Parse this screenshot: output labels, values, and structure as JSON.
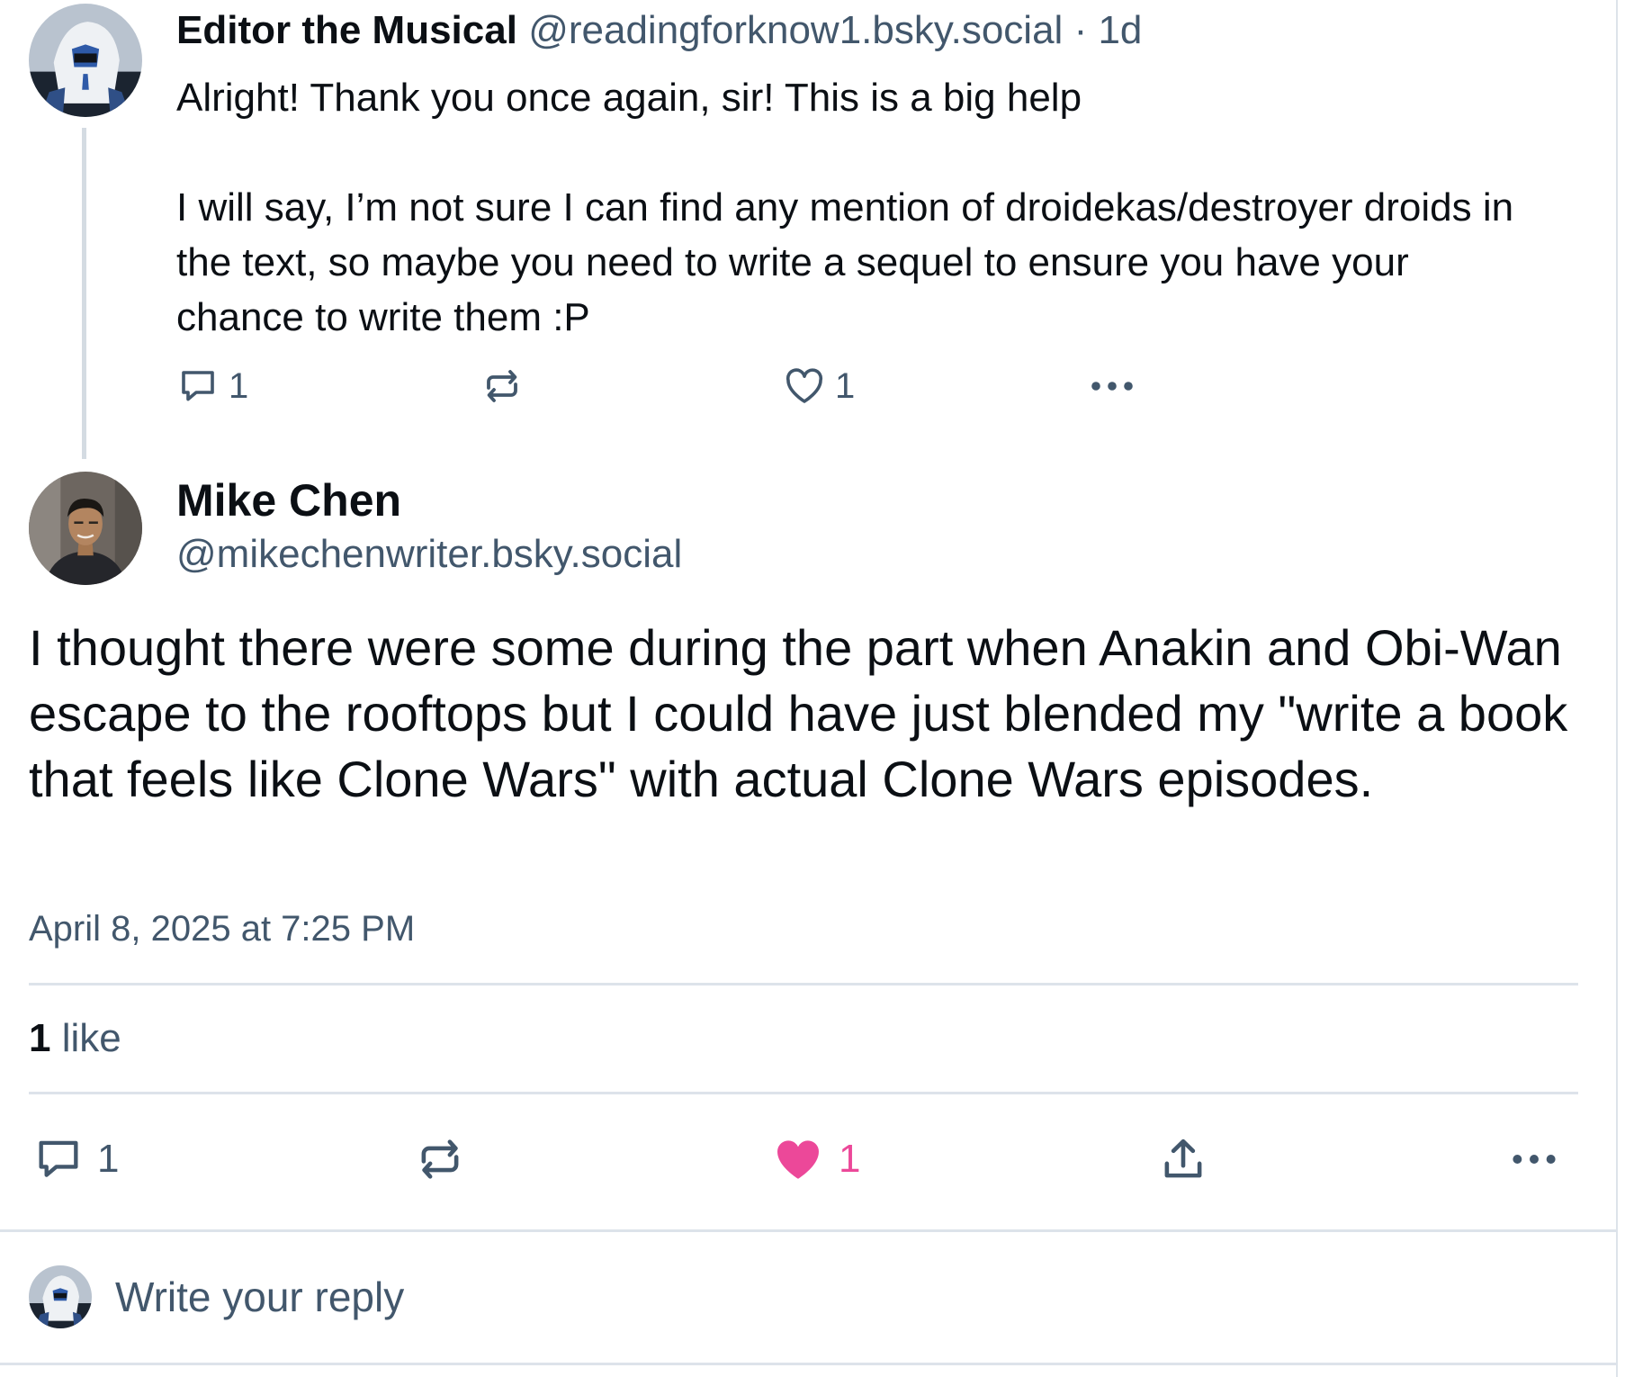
{
  "parent_post": {
    "author_name": "Editor the Musical",
    "handle": "@readingforknow1.bsky.social",
    "separator": "·",
    "age": "1d",
    "paragraphs": [
      "Alright! Thank you once again, sir! This is a big help",
      "I will say, I’m not sure I can find any mention of droidekas/destroyer droids in the text, so maybe you need to write a sequel to ensure you have your chance to write them :P"
    ],
    "reply_count": "1",
    "like_count": "1"
  },
  "main_post": {
    "author_name": "Mike Chen",
    "handle": "@mikechenwriter.bsky.social",
    "text": "I thought there were some during the part when Anakin and Obi-Wan escape to the rooftops but I could have just blended my \"write a book that feels like Clone Wars\" with actual Clone Wars episodes.",
    "timestamp": "April 8, 2025 at 7:25 PM",
    "likes_summary": {
      "count": "1",
      "label": "like"
    },
    "reply_count": "1",
    "like_count": "1",
    "liked": true
  },
  "composer": {
    "placeholder": "Write your reply"
  },
  "colors": {
    "text_primary": "#0b0f14",
    "text_secondary": "#42576c",
    "icon": "#42576c",
    "like_active": "#ec4899",
    "divider": "#dde3ea"
  }
}
